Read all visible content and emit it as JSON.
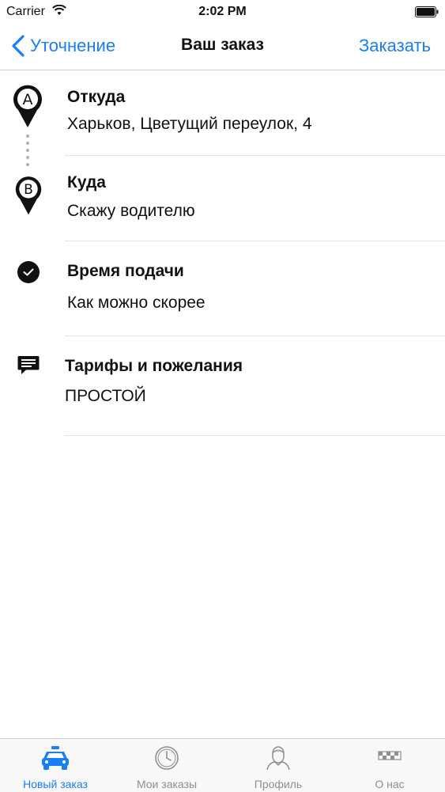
{
  "status_bar": {
    "carrier": "Carrier",
    "time": "2:02 PM"
  },
  "nav": {
    "back_label": "Уточнение",
    "title": "Ваш заказ",
    "action_label": "Заказать"
  },
  "rows": {
    "from": {
      "title": "Откуда",
      "value": "Харьков, Цветущий переулок, 4",
      "pin_letter": "A"
    },
    "to": {
      "title": "Куда",
      "value": "Скажу водителю",
      "pin_letter": "B"
    },
    "time": {
      "title": "Время подачи",
      "value": "Как можно скорее"
    },
    "tariff": {
      "title": "Тарифы и пожелания",
      "value": "ПРОСТОЙ"
    }
  },
  "tabs": [
    {
      "label": "Новый заказ",
      "icon": "car-icon",
      "active": true
    },
    {
      "label": "Мои заказы",
      "icon": "clock-icon",
      "active": false
    },
    {
      "label": "Профиль",
      "icon": "profile-icon",
      "active": false
    },
    {
      "label": "О нас",
      "icon": "taxi-checker-icon",
      "active": false
    }
  ],
  "colors": {
    "accent": "#1a7ef5",
    "inactive": "#8e8e93",
    "separator": "#e6e6e8"
  }
}
